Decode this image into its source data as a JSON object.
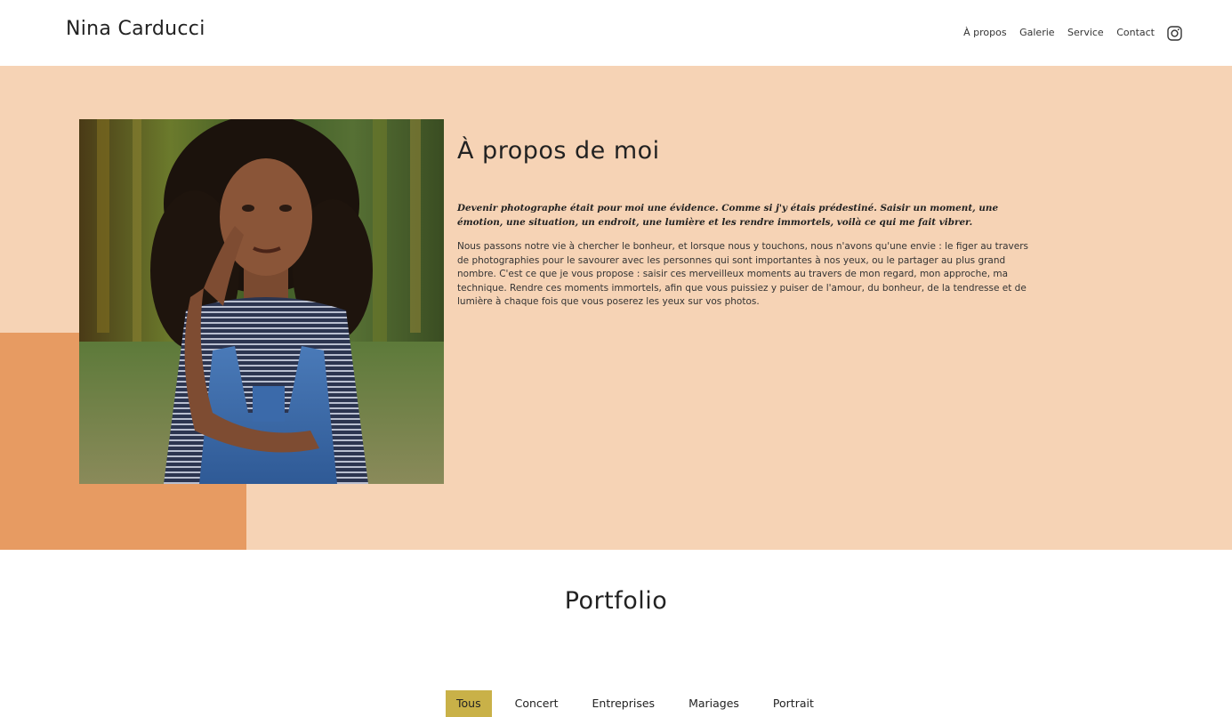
{
  "header": {
    "logo": "Nina Carducci",
    "nav": [
      {
        "label": "À propos"
      },
      {
        "label": "Galerie"
      },
      {
        "label": "Service"
      },
      {
        "label": "Contact"
      }
    ],
    "social_icon": "instagram-icon"
  },
  "about": {
    "title": "À propos de moi",
    "lead": "Devenir photographe était pour moi une évidence. Comme si j'y étais prédestiné. Saisir un moment, une émotion, une situation, un endroit, une lumière et les rendre immortels, voilà ce qui me fait vibrer.",
    "body": "Nous passons notre vie à chercher le bonheur, et lorsque nous y touchons, nous n'avons qu'une envie : le figer au travers de photographies pour le savourer avec les personnes qui sont importantes à nos yeux, ou le partager au plus grand nombre. C'est ce que je vous propose : saisir ces merveilleux moments au travers de mon regard, mon approche, ma technique. Rendre ces moments immortels, afin que vous puissiez y puiser de l'amour, du bonheur, de la tendresse et de lumière à chaque fois que vous poserez les yeux sur vos photos.",
    "colors": {
      "background": "#f6d3b5",
      "accent": "#e79b62"
    }
  },
  "portfolio": {
    "title": "Portfolio",
    "filters": [
      {
        "label": "Tous",
        "active": true
      },
      {
        "label": "Concert",
        "active": false
      },
      {
        "label": "Entreprises",
        "active": false
      },
      {
        "label": "Mariages",
        "active": false
      },
      {
        "label": "Portrait",
        "active": false
      }
    ],
    "active_color": "#c9b148"
  }
}
